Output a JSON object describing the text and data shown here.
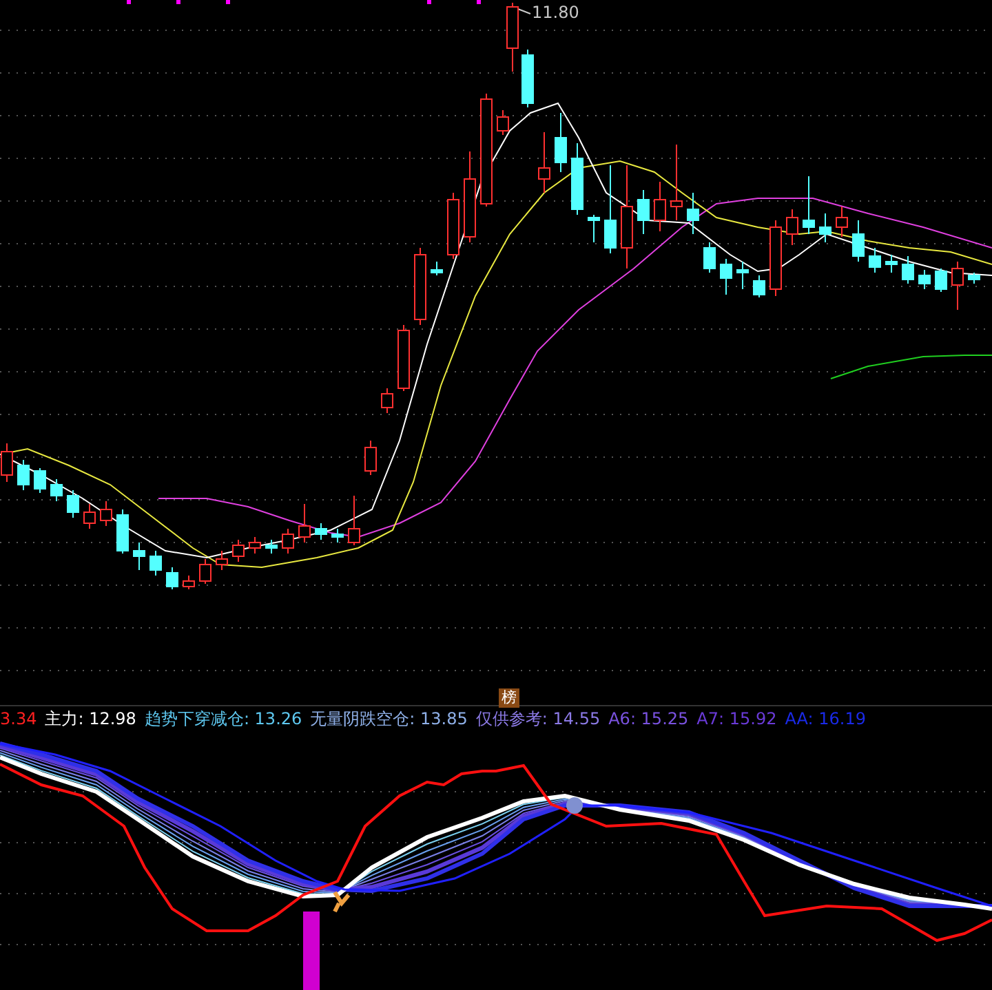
{
  "price_chart": {
    "high_label": "11.80"
  },
  "badge": "榜",
  "indicator_legend": [
    {
      "text": "3.34",
      "color": "#ff2020"
    },
    {
      "text": "主力: 12.98",
      "color": "#ffffff"
    },
    {
      "text": "趋势下穿减仓: 13.26",
      "color": "#5ec8f0"
    },
    {
      "text": "无量阴跌空仓: 13.85",
      "color": "#8fb0e8"
    },
    {
      "text": "仅供参考: 14.55",
      "color": "#8c7ae6"
    },
    {
      "text": "A6: 15.25",
      "color": "#7a52e0"
    },
    {
      "text": "A7: 15.92",
      "color": "#6a3ad8"
    },
    {
      "text": "AA: 16.19",
      "color": "#1a2ae8"
    }
  ]
}
